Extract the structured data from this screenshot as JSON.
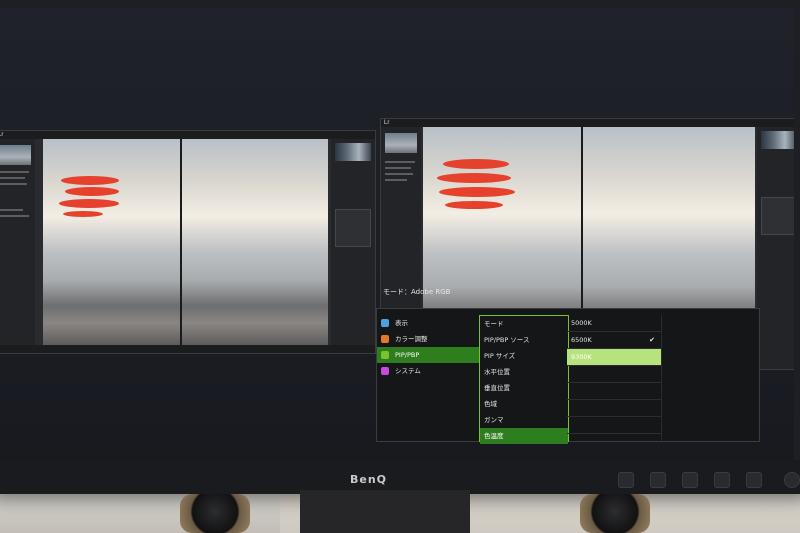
{
  "monitor": {
    "brand": "BenQ"
  },
  "lightroom": {
    "logo": "Lr"
  },
  "osd": {
    "title": "モード：Adobe RGB",
    "main_menu": [
      {
        "label": "表示",
        "icon": "display-icon",
        "color": "#4aa3df"
      },
      {
        "label": "カラー調整",
        "icon": "color-adjust-icon",
        "color": "#e07a24"
      },
      {
        "label": "PIP/PBP",
        "icon": "pip-icon",
        "color": "#7bc22f",
        "selected": true
      },
      {
        "label": "システム",
        "icon": "wrench-icon",
        "color": "#c94ad6"
      }
    ],
    "sub_menu": [
      {
        "label": "モード"
      },
      {
        "label": "PIP/PBP ソース"
      },
      {
        "label": "PIP サイズ"
      },
      {
        "label": "水平位置"
      },
      {
        "label": "垂直位置"
      },
      {
        "label": "色域"
      },
      {
        "label": "ガンマ"
      },
      {
        "label": "色温度",
        "selected": true
      }
    ],
    "options": [
      {
        "label": "5000K"
      },
      {
        "label": "6500K",
        "checked": true
      },
      {
        "label": "9300K",
        "highlighted": true
      },
      {
        "label": ""
      },
      {
        "label": ""
      },
      {
        "label": ""
      },
      {
        "label": ""
      }
    ],
    "hotkeys": [
      "⌃",
      "⌄",
      "✔",
      "<",
      "✖"
    ],
    "accent_color": "#7bc22f"
  }
}
